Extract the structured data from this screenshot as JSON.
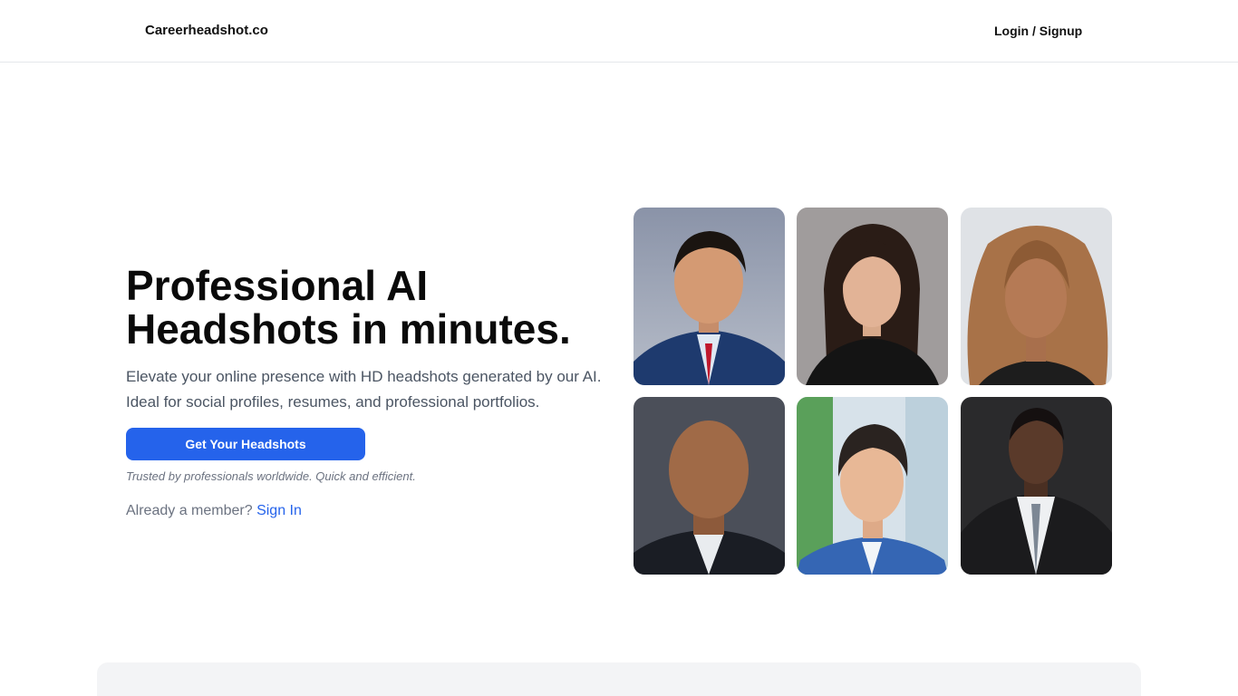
{
  "header": {
    "brand": "Careerheadshot.co",
    "login_label": "Login / Signup"
  },
  "hero": {
    "title_line1": "Professional AI",
    "title_line2": "Headshots in minutes.",
    "subtitle": "Elevate your online presence with HD headshots generated by our AI. Ideal for social profiles, resumes, and professional portfolios.",
    "cta_label": "Get Your Headshots",
    "trust_note": "Trusted by professionals worldwide. Quick and efficient.",
    "member_prompt": "Already a member?",
    "sign_in_label": "Sign In"
  },
  "colors": {
    "accent": "#2563eb",
    "text_muted": "#4b5563",
    "panel": "#f3f4f6"
  },
  "headshots": [
    "man-navy-suit-red-tie",
    "woman-dark-hair-black-blazer",
    "woman-wavy-hair-black-top",
    "bald-man-dark-suit",
    "young-man-blue-suit",
    "man-black-suit-grey-tie"
  ]
}
